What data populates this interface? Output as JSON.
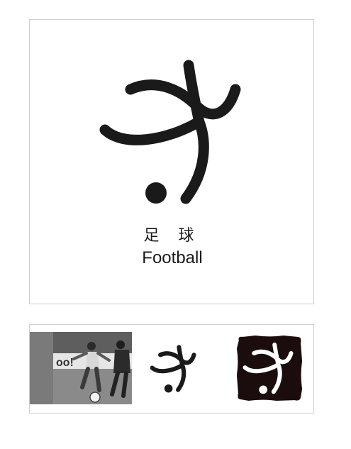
{
  "sport": {
    "name_chinese": "足 球",
    "name_english": "Football"
  },
  "colors": {
    "ink": "#1a1a1a",
    "seal": "#1b0d0d",
    "border": "#cfcfcf",
    "photo_side": "#7a7a7a"
  },
  "icons": {
    "main": "football-pictogram-icon",
    "small": "football-pictogram-small-icon",
    "seal": "football-seal-icon"
  }
}
